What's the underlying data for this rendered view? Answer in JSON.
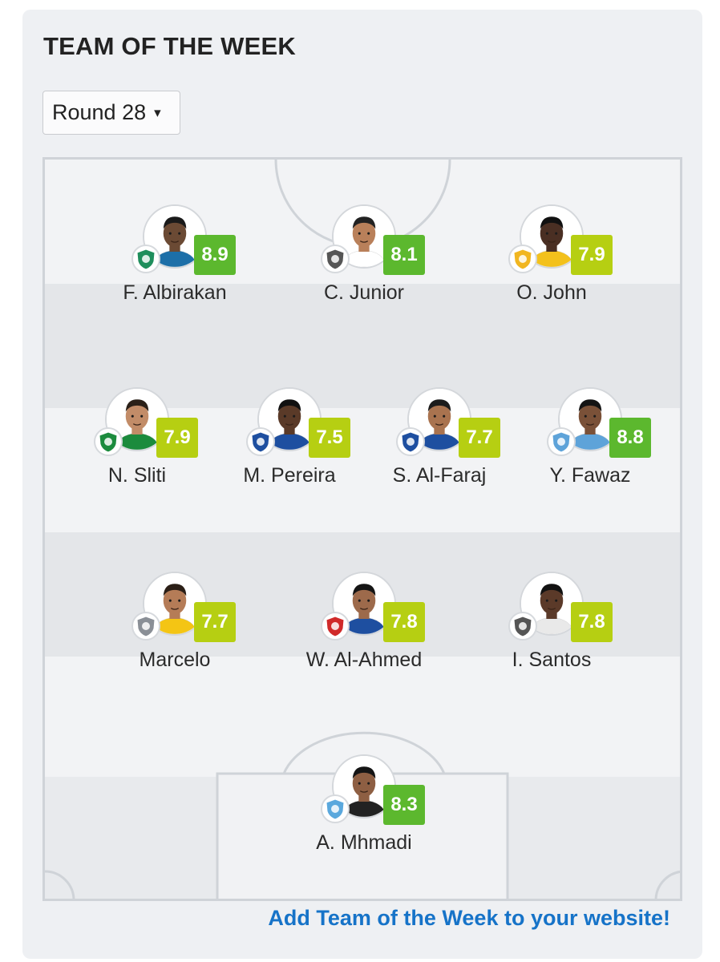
{
  "header": {
    "title": "TEAM OF THE WEEK"
  },
  "round_select": {
    "value": "Round 28",
    "caret": "▾"
  },
  "colors": {
    "rating_high": "#5cb82e",
    "rating_mid": "#b6cf12",
    "link": "#1673c8"
  },
  "players": [
    {
      "name": "F. Albirakan",
      "rating": "8.9",
      "level": "high",
      "club_icon": "al-fateh-badge-icon",
      "club_color": "#1f8e5c",
      "skin": "#6b4a34",
      "hair": "#1a1a1a",
      "shirt": "#1d6fa8"
    },
    {
      "name": "C. Junior",
      "rating": "8.1",
      "level": "high",
      "club_icon": "al-shabab-badge-icon",
      "club_color": "#555555",
      "skin": "#b9805a",
      "hair": "#222222",
      "shirt": "#ffffff"
    },
    {
      "name": "O. John",
      "rating": "7.9",
      "level": "mid",
      "club_icon": "al-hazem-badge-icon",
      "club_color": "#f1b620",
      "skin": "#4a2f23",
      "hair": "#111111",
      "shirt": "#f3c11c"
    },
    {
      "name": "N. Sliti",
      "rating": "7.9",
      "level": "mid",
      "club_icon": "al-ettifaq-badge-icon",
      "club_color": "#1b8b3d",
      "skin": "#c28c68",
      "hair": "#2a2018",
      "shirt": "#1b8b3d"
    },
    {
      "name": "M. Pereira",
      "rating": "7.5",
      "level": "mid",
      "club_icon": "al-hilal-badge-icon",
      "club_color": "#1e4fa0",
      "skin": "#5a3a28",
      "hair": "#111111",
      "shirt": "#1e4fa0"
    },
    {
      "name": "S. Al-Faraj",
      "rating": "7.7",
      "level": "mid",
      "club_icon": "al-hilal-badge-icon",
      "club_color": "#1e4fa0",
      "skin": "#a9734f",
      "hair": "#1c1c1c",
      "shirt": "#1e4fa0"
    },
    {
      "name": "Y. Fawaz",
      "rating": "8.8",
      "level": "high",
      "club_icon": "al-batin-badge-icon",
      "club_color": "#5ea3d9",
      "skin": "#7a5138",
      "hair": "#141414",
      "shirt": "#5ea3d9"
    },
    {
      "name": "Marcelo",
      "rating": "7.7",
      "level": "mid",
      "club_icon": "al-faisaly-badge-icon",
      "club_color": "#8a8f96",
      "skin": "#b57c57",
      "hair": "#2b1f17",
      "shirt": "#f4c514"
    },
    {
      "name": "W. Al-Ahmed",
      "rating": "7.8",
      "level": "mid",
      "club_icon": "damac-badge-icon",
      "club_color": "#d02a2a",
      "skin": "#9d6a4b",
      "hair": "#151515",
      "shirt": "#1e4fa0"
    },
    {
      "name": "I. Santos",
      "rating": "7.8",
      "level": "mid",
      "club_icon": "al-shabab-badge-icon",
      "club_color": "#555555",
      "skin": "#5b3a29",
      "hair": "#121212",
      "shirt": "#e9e9e9"
    },
    {
      "name": "A. Mhmadi",
      "rating": "8.3",
      "level": "high",
      "club_icon": "abha-badge-icon",
      "club_color": "#5aa8dd",
      "skin": "#8e5f43",
      "hair": "#151515",
      "shirt": "#222222"
    }
  ],
  "footer": {
    "link_text": "Add Team of the Week to your website!"
  }
}
